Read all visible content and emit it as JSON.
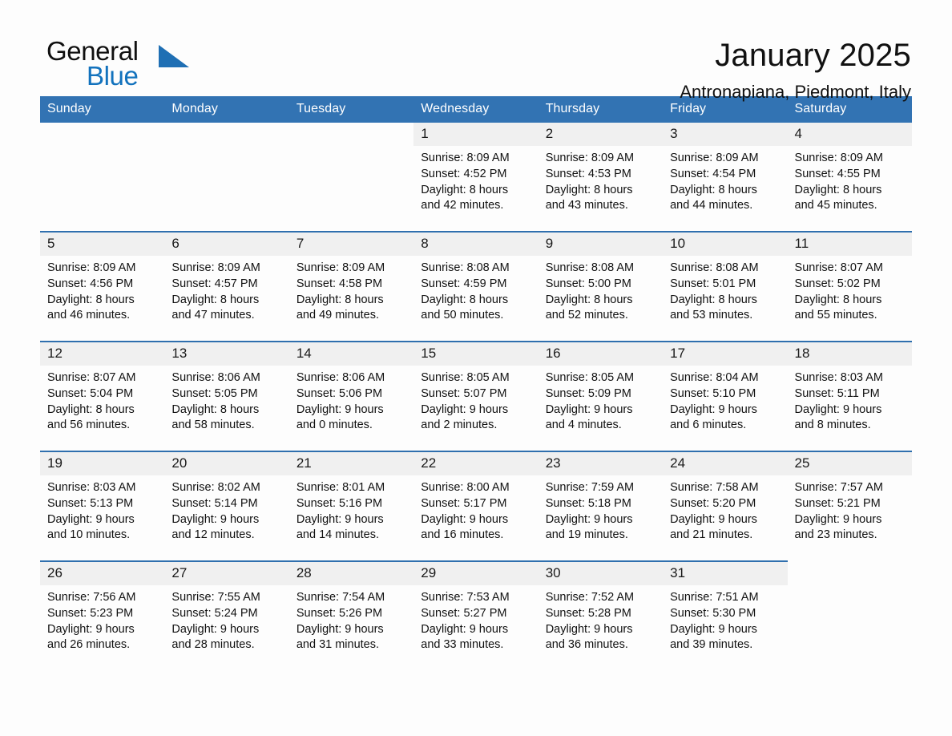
{
  "brand": {
    "name_part1": "General",
    "name_part2": "Blue",
    "accent_color": "#1272bd",
    "triangle_color": "#1f6fb4"
  },
  "header": {
    "title": "January 2025",
    "subtitle": "Antronapiana, Piedmont, Italy"
  },
  "calendar": {
    "header_bg": "#3273b3",
    "weekday_headers": [
      "Sunday",
      "Monday",
      "Tuesday",
      "Wednesday",
      "Thursday",
      "Friday",
      "Saturday"
    ],
    "weeks": [
      [
        {
          "day": ""
        },
        {
          "day": ""
        },
        {
          "day": ""
        },
        {
          "day": "1",
          "sunrise": "Sunrise: 8:09 AM",
          "sunset": "Sunset: 4:52 PM",
          "daylight_line1": "Daylight: 8 hours",
          "daylight_line2": "and 42 minutes."
        },
        {
          "day": "2",
          "sunrise": "Sunrise: 8:09 AM",
          "sunset": "Sunset: 4:53 PM",
          "daylight_line1": "Daylight: 8 hours",
          "daylight_line2": "and 43 minutes."
        },
        {
          "day": "3",
          "sunrise": "Sunrise: 8:09 AM",
          "sunset": "Sunset: 4:54 PM",
          "daylight_line1": "Daylight: 8 hours",
          "daylight_line2": "and 44 minutes."
        },
        {
          "day": "4",
          "sunrise": "Sunrise: 8:09 AM",
          "sunset": "Sunset: 4:55 PM",
          "daylight_line1": "Daylight: 8 hours",
          "daylight_line2": "and 45 minutes."
        }
      ],
      [
        {
          "day": "5",
          "sunrise": "Sunrise: 8:09 AM",
          "sunset": "Sunset: 4:56 PM",
          "daylight_line1": "Daylight: 8 hours",
          "daylight_line2": "and 46 minutes."
        },
        {
          "day": "6",
          "sunrise": "Sunrise: 8:09 AM",
          "sunset": "Sunset: 4:57 PM",
          "daylight_line1": "Daylight: 8 hours",
          "daylight_line2": "and 47 minutes."
        },
        {
          "day": "7",
          "sunrise": "Sunrise: 8:09 AM",
          "sunset": "Sunset: 4:58 PM",
          "daylight_line1": "Daylight: 8 hours",
          "daylight_line2": "and 49 minutes."
        },
        {
          "day": "8",
          "sunrise": "Sunrise: 8:08 AM",
          "sunset": "Sunset: 4:59 PM",
          "daylight_line1": "Daylight: 8 hours",
          "daylight_line2": "and 50 minutes."
        },
        {
          "day": "9",
          "sunrise": "Sunrise: 8:08 AM",
          "sunset": "Sunset: 5:00 PM",
          "daylight_line1": "Daylight: 8 hours",
          "daylight_line2": "and 52 minutes."
        },
        {
          "day": "10",
          "sunrise": "Sunrise: 8:08 AM",
          "sunset": "Sunset: 5:01 PM",
          "daylight_line1": "Daylight: 8 hours",
          "daylight_line2": "and 53 minutes."
        },
        {
          "day": "11",
          "sunrise": "Sunrise: 8:07 AM",
          "sunset": "Sunset: 5:02 PM",
          "daylight_line1": "Daylight: 8 hours",
          "daylight_line2": "and 55 minutes."
        }
      ],
      [
        {
          "day": "12",
          "sunrise": "Sunrise: 8:07 AM",
          "sunset": "Sunset: 5:04 PM",
          "daylight_line1": "Daylight: 8 hours",
          "daylight_line2": "and 56 minutes."
        },
        {
          "day": "13",
          "sunrise": "Sunrise: 8:06 AM",
          "sunset": "Sunset: 5:05 PM",
          "daylight_line1": "Daylight: 8 hours",
          "daylight_line2": "and 58 minutes."
        },
        {
          "day": "14",
          "sunrise": "Sunrise: 8:06 AM",
          "sunset": "Sunset: 5:06 PM",
          "daylight_line1": "Daylight: 9 hours",
          "daylight_line2": "and 0 minutes."
        },
        {
          "day": "15",
          "sunrise": "Sunrise: 8:05 AM",
          "sunset": "Sunset: 5:07 PM",
          "daylight_line1": "Daylight: 9 hours",
          "daylight_line2": "and 2 minutes."
        },
        {
          "day": "16",
          "sunrise": "Sunrise: 8:05 AM",
          "sunset": "Sunset: 5:09 PM",
          "daylight_line1": "Daylight: 9 hours",
          "daylight_line2": "and 4 minutes."
        },
        {
          "day": "17",
          "sunrise": "Sunrise: 8:04 AM",
          "sunset": "Sunset: 5:10 PM",
          "daylight_line1": "Daylight: 9 hours",
          "daylight_line2": "and 6 minutes."
        },
        {
          "day": "18",
          "sunrise": "Sunrise: 8:03 AM",
          "sunset": "Sunset: 5:11 PM",
          "daylight_line1": "Daylight: 9 hours",
          "daylight_line2": "and 8 minutes."
        }
      ],
      [
        {
          "day": "19",
          "sunrise": "Sunrise: 8:03 AM",
          "sunset": "Sunset: 5:13 PM",
          "daylight_line1": "Daylight: 9 hours",
          "daylight_line2": "and 10 minutes."
        },
        {
          "day": "20",
          "sunrise": "Sunrise: 8:02 AM",
          "sunset": "Sunset: 5:14 PM",
          "daylight_line1": "Daylight: 9 hours",
          "daylight_line2": "and 12 minutes."
        },
        {
          "day": "21",
          "sunrise": "Sunrise: 8:01 AM",
          "sunset": "Sunset: 5:16 PM",
          "daylight_line1": "Daylight: 9 hours",
          "daylight_line2": "and 14 minutes."
        },
        {
          "day": "22",
          "sunrise": "Sunrise: 8:00 AM",
          "sunset": "Sunset: 5:17 PM",
          "daylight_line1": "Daylight: 9 hours",
          "daylight_line2": "and 16 minutes."
        },
        {
          "day": "23",
          "sunrise": "Sunrise: 7:59 AM",
          "sunset": "Sunset: 5:18 PM",
          "daylight_line1": "Daylight: 9 hours",
          "daylight_line2": "and 19 minutes."
        },
        {
          "day": "24",
          "sunrise": "Sunrise: 7:58 AM",
          "sunset": "Sunset: 5:20 PM",
          "daylight_line1": "Daylight: 9 hours",
          "daylight_line2": "and 21 minutes."
        },
        {
          "day": "25",
          "sunrise": "Sunrise: 7:57 AM",
          "sunset": "Sunset: 5:21 PM",
          "daylight_line1": "Daylight: 9 hours",
          "daylight_line2": "and 23 minutes."
        }
      ],
      [
        {
          "day": "26",
          "sunrise": "Sunrise: 7:56 AM",
          "sunset": "Sunset: 5:23 PM",
          "daylight_line1": "Daylight: 9 hours",
          "daylight_line2": "and 26 minutes."
        },
        {
          "day": "27",
          "sunrise": "Sunrise: 7:55 AM",
          "sunset": "Sunset: 5:24 PM",
          "daylight_line1": "Daylight: 9 hours",
          "daylight_line2": "and 28 minutes."
        },
        {
          "day": "28",
          "sunrise": "Sunrise: 7:54 AM",
          "sunset": "Sunset: 5:26 PM",
          "daylight_line1": "Daylight: 9 hours",
          "daylight_line2": "and 31 minutes."
        },
        {
          "day": "29",
          "sunrise": "Sunrise: 7:53 AM",
          "sunset": "Sunset: 5:27 PM",
          "daylight_line1": "Daylight: 9 hours",
          "daylight_line2": "and 33 minutes."
        },
        {
          "day": "30",
          "sunrise": "Sunrise: 7:52 AM",
          "sunset": "Sunset: 5:28 PM",
          "daylight_line1": "Daylight: 9 hours",
          "daylight_line2": "and 36 minutes."
        },
        {
          "day": "31",
          "sunrise": "Sunrise: 7:51 AM",
          "sunset": "Sunset: 5:30 PM",
          "daylight_line1": "Daylight: 9 hours",
          "daylight_line2": "and 39 minutes."
        },
        {
          "day": ""
        }
      ]
    ]
  }
}
